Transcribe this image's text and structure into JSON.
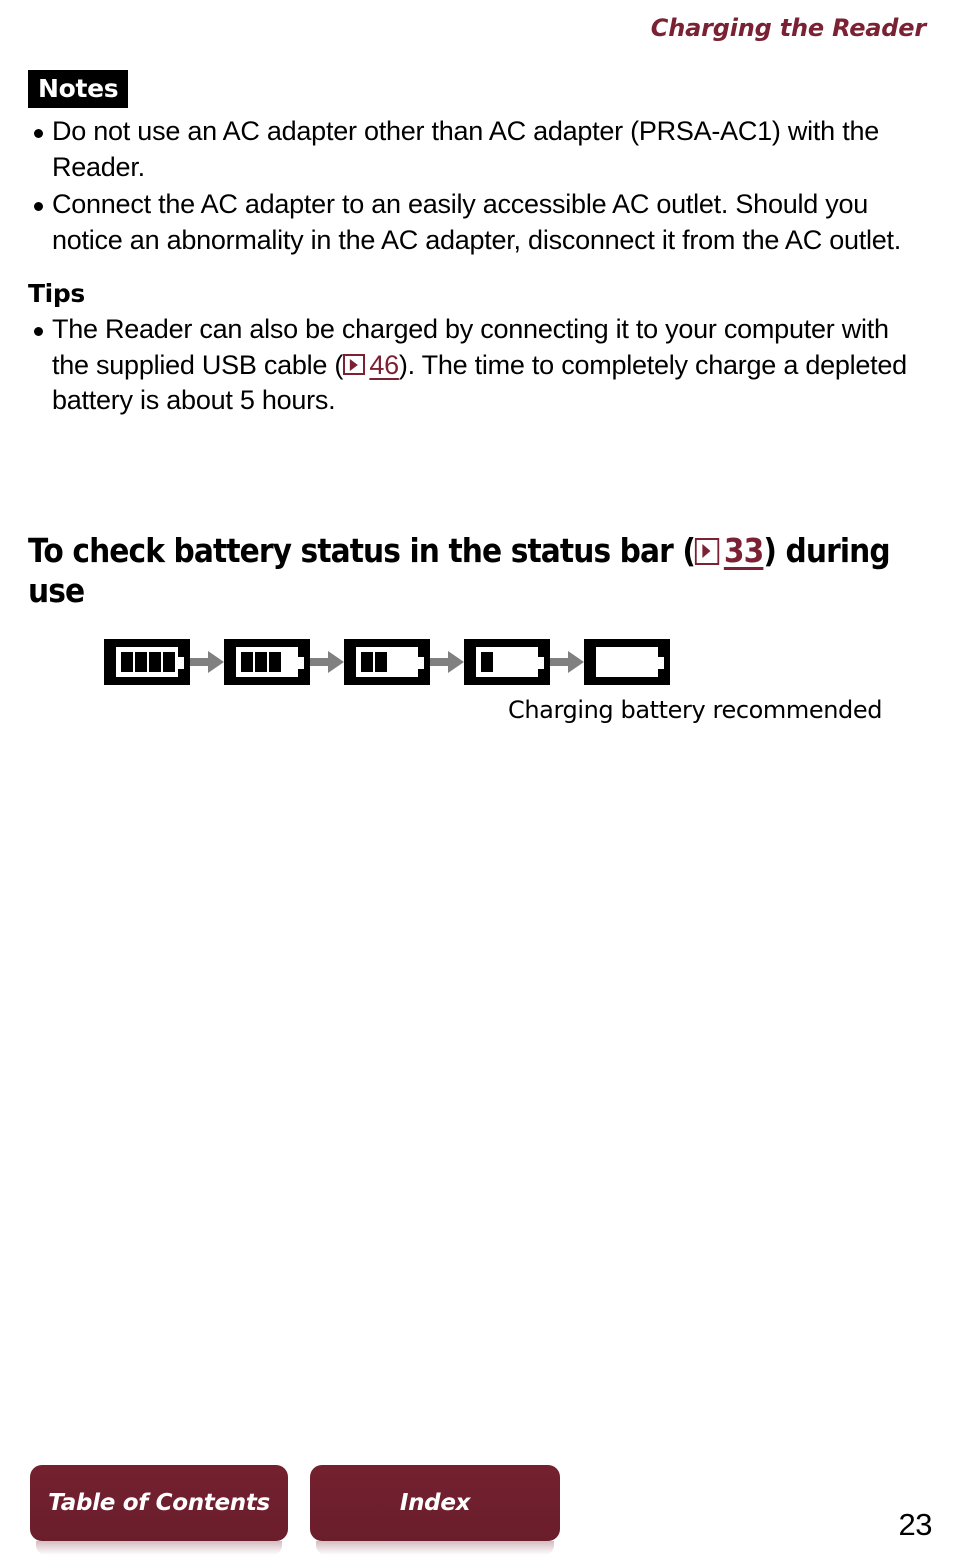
{
  "header": {
    "running_title": "Charging the Reader"
  },
  "notes": {
    "badge_label": "Notes",
    "items": [
      "Do not use an AC adapter other than AC adapter (PRSA-AC1) with the Reader.",
      "Connect the AC adapter to an easily accessible AC outlet. Should you notice an abnormality in the AC adapter, disconnect it from the AC outlet."
    ]
  },
  "tips": {
    "heading": "Tips",
    "item_part1": "The Reader can also be charged by connecting it to your computer with the supplied USB cable (",
    "ref_page": "46",
    "item_part2": "). The time to completely charge a depleted battery is about 5 hours."
  },
  "section": {
    "heading_part1": "To check battery status in the status bar (",
    "ref_page": "33",
    "heading_part2": ") during use"
  },
  "battery_diagram": {
    "states": [
      {
        "label": "full",
        "cells": 4
      },
      {
        "label": "three-quarters",
        "cells": 3
      },
      {
        "label": "half",
        "cells": 2
      },
      {
        "label": "low",
        "cells": 1
      },
      {
        "label": "empty",
        "cells": 0
      }
    ],
    "caption": "Charging battery recommended",
    "arrow_color": "#808080",
    "tile_background": "#000000",
    "battery_outline": "#ffffff",
    "cell_fill": "#000000"
  },
  "footer": {
    "toc_label": "Table of Contents",
    "index_label": "Index",
    "button_color": "#74202f",
    "page_number": "23"
  },
  "accent_color": "#7a2233"
}
